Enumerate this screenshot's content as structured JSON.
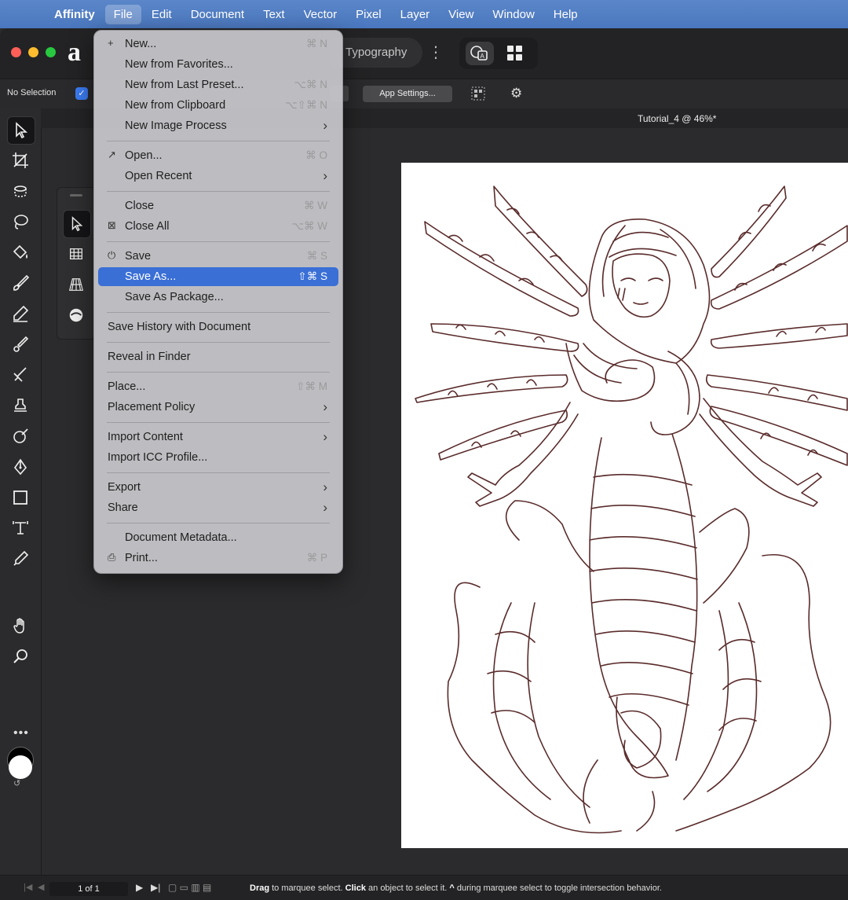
{
  "menubar": {
    "app": "Affinity",
    "items": [
      "File",
      "Edit",
      "Document",
      "Text",
      "Vector",
      "Pixel",
      "Layer",
      "View",
      "Window",
      "Help"
    ],
    "active": "File"
  },
  "titlebar": {
    "persona_label": "Typography"
  },
  "context_toolbar": {
    "selection_status": "No Selection",
    "app_settings_label": "App Settings..."
  },
  "document": {
    "tab_title": "Tutorial_4 @ 46%*"
  },
  "file_menu": {
    "items": [
      {
        "label": "New...",
        "shortcut": "⌘ N",
        "icon": "+"
      },
      {
        "label": "New from Favorites...",
        "shortcut": ""
      },
      {
        "label": "New from Last Preset...",
        "shortcut": "⌥⌘ N"
      },
      {
        "label": "New from Clipboard",
        "shortcut": "⌥⇧⌘ N"
      },
      {
        "label": "New Image Process",
        "submenu": "›"
      },
      {
        "label": "Open...",
        "shortcut": "⌘ O",
        "icon": "↗"
      },
      {
        "label": "Open Recent",
        "submenu": "›"
      },
      {
        "label": "Close",
        "shortcut": "⌘ W"
      },
      {
        "label": "Close All",
        "shortcut": "⌥⌘ W"
      },
      {
        "label": "Save",
        "shortcut": "⌘ S"
      },
      {
        "label": "Save As...",
        "shortcut": "⇧⌘ S"
      },
      {
        "label": "Save As Package..."
      },
      {
        "label": "Save History with Document"
      },
      {
        "label": "Reveal in Finder"
      },
      {
        "label": "Place...",
        "shortcut": "⇧⌘ M"
      },
      {
        "label": "Placement Policy",
        "submenu": "›"
      },
      {
        "label": "Import Content",
        "submenu": "›"
      },
      {
        "label": "Import ICC Profile..."
      },
      {
        "label": "Export",
        "submenu": "›"
      },
      {
        "label": "Share",
        "submenu": "›"
      },
      {
        "label": "Document Metadata..."
      },
      {
        "label": "Print...",
        "shortcut": "⌘ P"
      }
    ],
    "highlighted": "Save As..."
  },
  "statusbar": {
    "page_indicator": "1 of 1",
    "hint_parts": [
      "Drag",
      " to marquee select. ",
      "Click",
      " an object to select it. ",
      "^",
      " during marquee select to toggle intersection behavior."
    ]
  },
  "colors": {
    "accent": "#3a6fd6",
    "menubar": "#4f7cc4",
    "traffic_close": "#ff5f57",
    "traffic_min": "#febc2e",
    "traffic_max": "#28c840"
  }
}
